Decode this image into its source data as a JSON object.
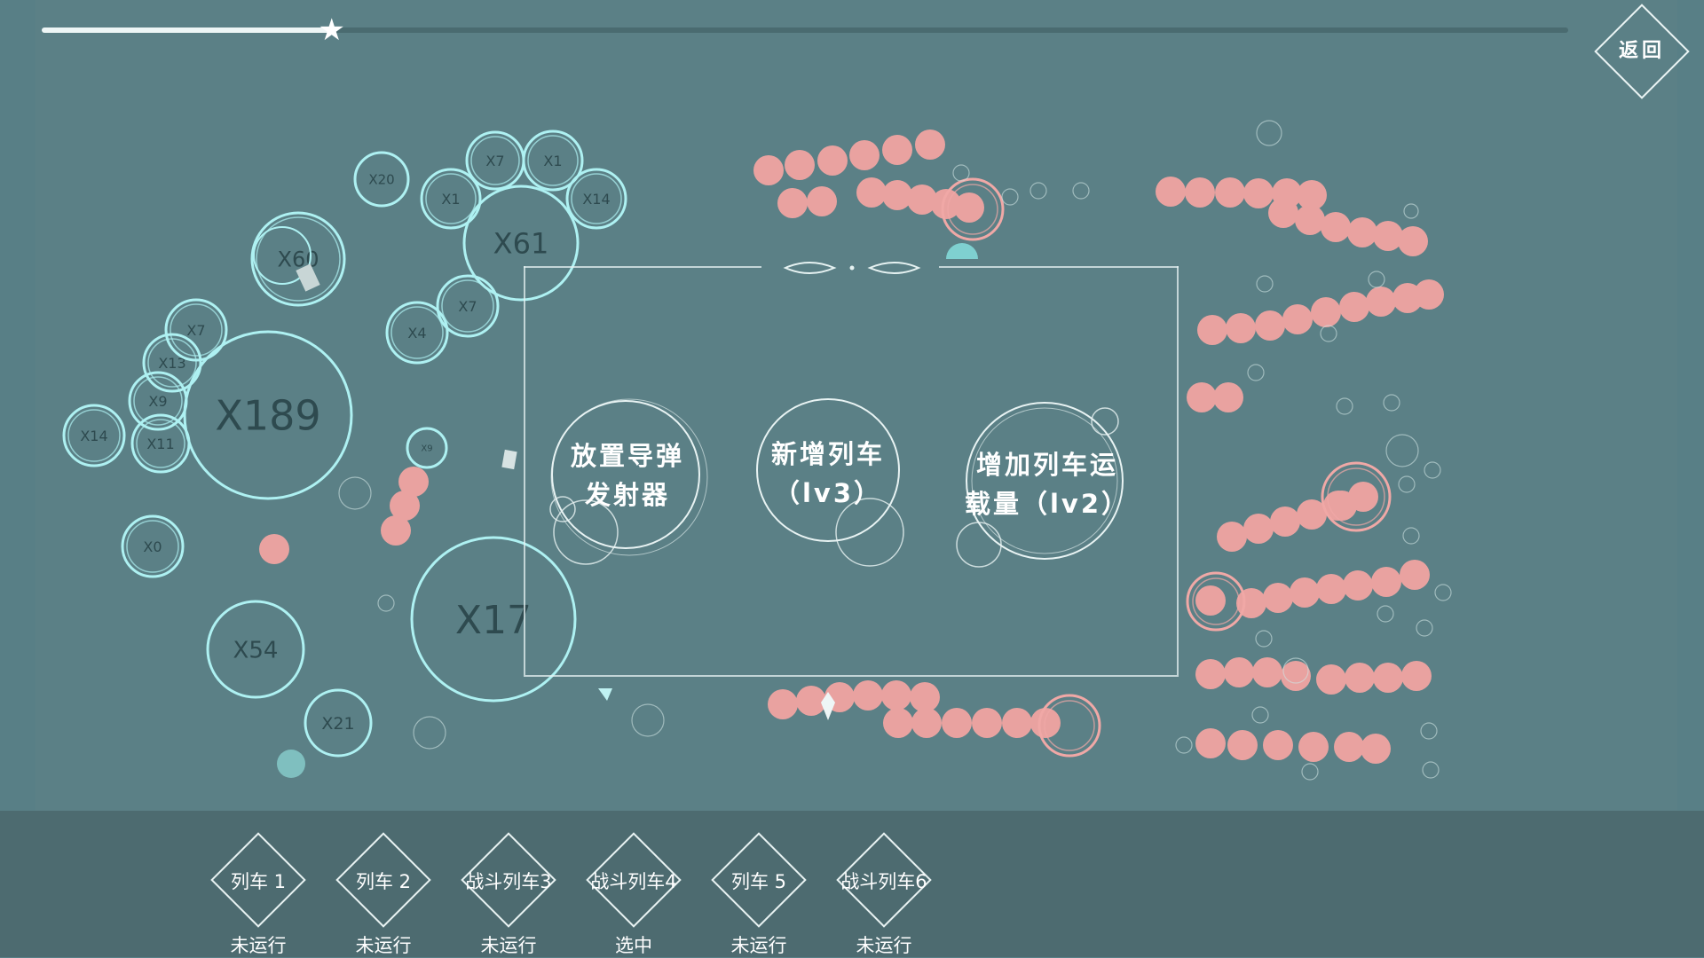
{
  "colors": {
    "background": "#587f86",
    "ally_circle": "#aef1f2",
    "enemy_dot": "#e9a2a0",
    "enemy_ring": "#f0a8a6",
    "bottom_bar": "#4d6b70",
    "ui_white": "#eef6f6"
  },
  "progress": {
    "fraction": 0.19,
    "marker_icon": "star-icon"
  },
  "back_button": {
    "label": "返回"
  },
  "upgrade_menu": {
    "options": [
      {
        "line1": "放置导弹",
        "line2": "发射器"
      },
      {
        "line1": "新增列车",
        "line2": "（lv3）"
      },
      {
        "line1": "增加列车运",
        "line2": "载量（lv2）"
      }
    ]
  },
  "ally_nodes": [
    {
      "label": "X189"
    },
    {
      "label": "X61"
    },
    {
      "label": "X60"
    },
    {
      "label": "X17"
    },
    {
      "label": "X54"
    },
    {
      "label": "X21"
    },
    {
      "label": "X20"
    },
    {
      "label": "X14"
    },
    {
      "label": "X13"
    },
    {
      "label": "X11"
    },
    {
      "label": "X9"
    },
    {
      "label": "X7"
    },
    {
      "label": "X7"
    },
    {
      "label": "X7"
    },
    {
      "label": "X4"
    },
    {
      "label": "X1"
    },
    {
      "label": "X1"
    },
    {
      "label": "X14"
    },
    {
      "label": "X0"
    },
    {
      "label": "X9"
    }
  ],
  "trains": [
    {
      "name": "列车 1",
      "status": "未运行"
    },
    {
      "name": "列车 2",
      "status": "未运行"
    },
    {
      "name": "战斗列车3",
      "status": "未运行"
    },
    {
      "name": "战斗列车4",
      "status": "选中"
    },
    {
      "name": "列车 5",
      "status": "未运行"
    },
    {
      "name": "战斗列车6",
      "status": "未运行"
    }
  ]
}
